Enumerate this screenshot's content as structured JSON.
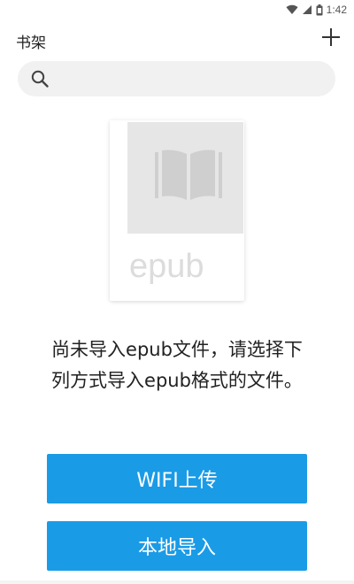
{
  "status_bar": {
    "time": "1:42",
    "icons": [
      "wifi-icon",
      "signal-icon",
      "battery-icon"
    ]
  },
  "header": {
    "title": "书架",
    "add_icon": "plus-icon"
  },
  "search": {
    "icon": "search-icon",
    "value": "",
    "placeholder": ""
  },
  "empty_state": {
    "cover_icon": "book-icon",
    "format_label": "epub",
    "message": "尚未导入epub文件，请选择下列方式导入epub格式的文件。"
  },
  "actions": {
    "wifi_upload": "WIFI上传",
    "local_import": "本地导入"
  },
  "colors": {
    "accent": "#1a9be6",
    "search_bg": "#f1f1f1",
    "cover_bg": "#e6e6e6"
  }
}
